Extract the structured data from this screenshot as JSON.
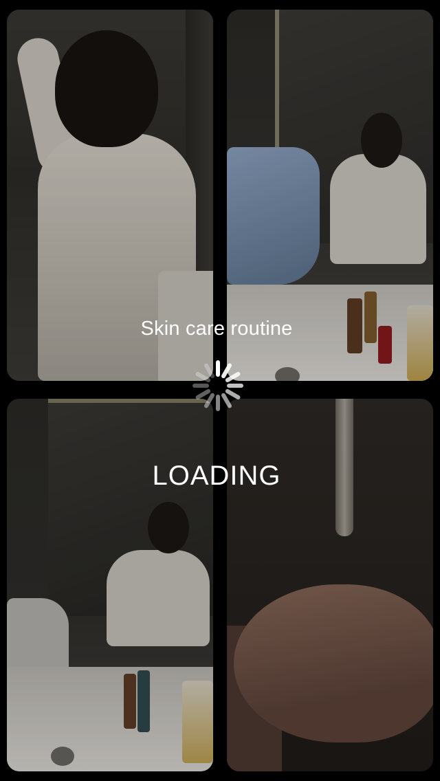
{
  "overlay": {
    "title": "Skin care routine",
    "status": "LOADING"
  },
  "icons": {
    "spinner": "loading-spinner-icon"
  },
  "colors": {
    "background": "#000000",
    "text": "#ffffff"
  }
}
